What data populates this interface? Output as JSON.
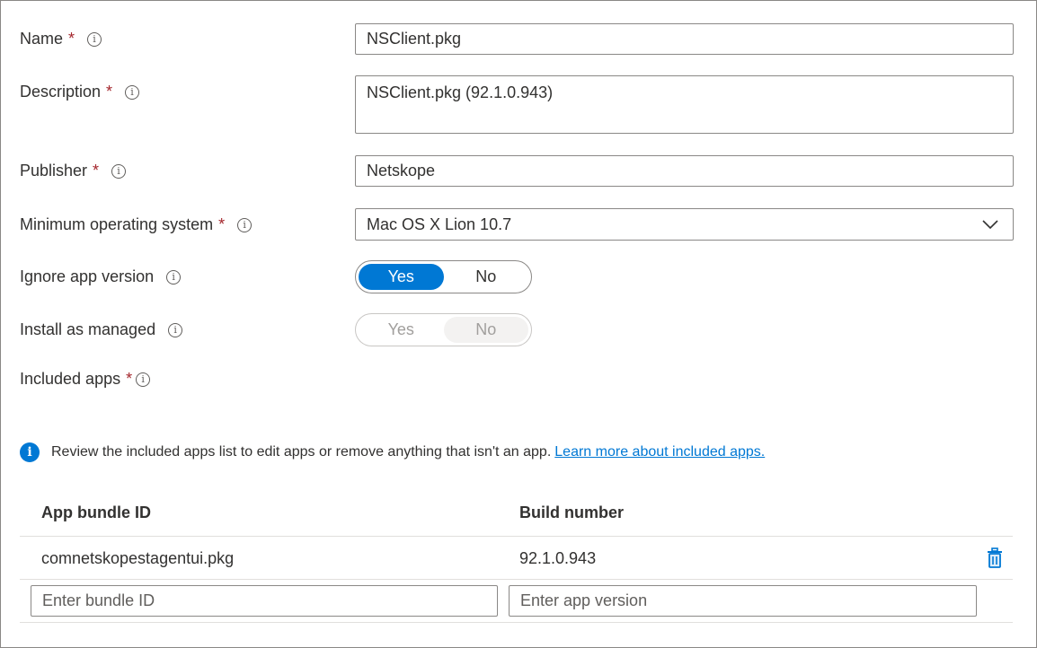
{
  "form": {
    "name": {
      "label": "Name",
      "value": "NSClient.pkg"
    },
    "description": {
      "label": "Description",
      "value": "NSClient.pkg (92.1.0.943)"
    },
    "publisher": {
      "label": "Publisher",
      "value": "Netskope"
    },
    "min_os": {
      "label": "Minimum operating system",
      "value": "Mac OS X Lion 10.7"
    },
    "ignore_app_version": {
      "label": "Ignore app version",
      "yes": "Yes",
      "no": "No",
      "selected": "Yes"
    },
    "install_as_managed": {
      "label": "Install as managed",
      "yes": "Yes",
      "no": "No",
      "selected": "No",
      "disabled": true
    },
    "included_apps": {
      "label": "Included apps"
    },
    "required_marker": "*",
    "info_glyph": "i"
  },
  "notice": {
    "icon_glyph": "i",
    "text": "Review the included apps list to edit apps or remove anything that isn't an app.",
    "link": "Learn more about included apps."
  },
  "table": {
    "headers": [
      "App bundle ID",
      "Build number"
    ],
    "rows": [
      {
        "bundle_id": "comnetskopestagentui.pkg",
        "build": "92.1.0.943"
      }
    ],
    "new_row": {
      "bundle_placeholder": "Enter bundle ID",
      "version_placeholder": "Enter app version"
    }
  },
  "colors": {
    "accent": "#0078d4",
    "required": "#a4262c",
    "border": "#8a8886"
  },
  "icons": [
    "info-icon",
    "chevron-down-icon",
    "trash-icon"
  ]
}
